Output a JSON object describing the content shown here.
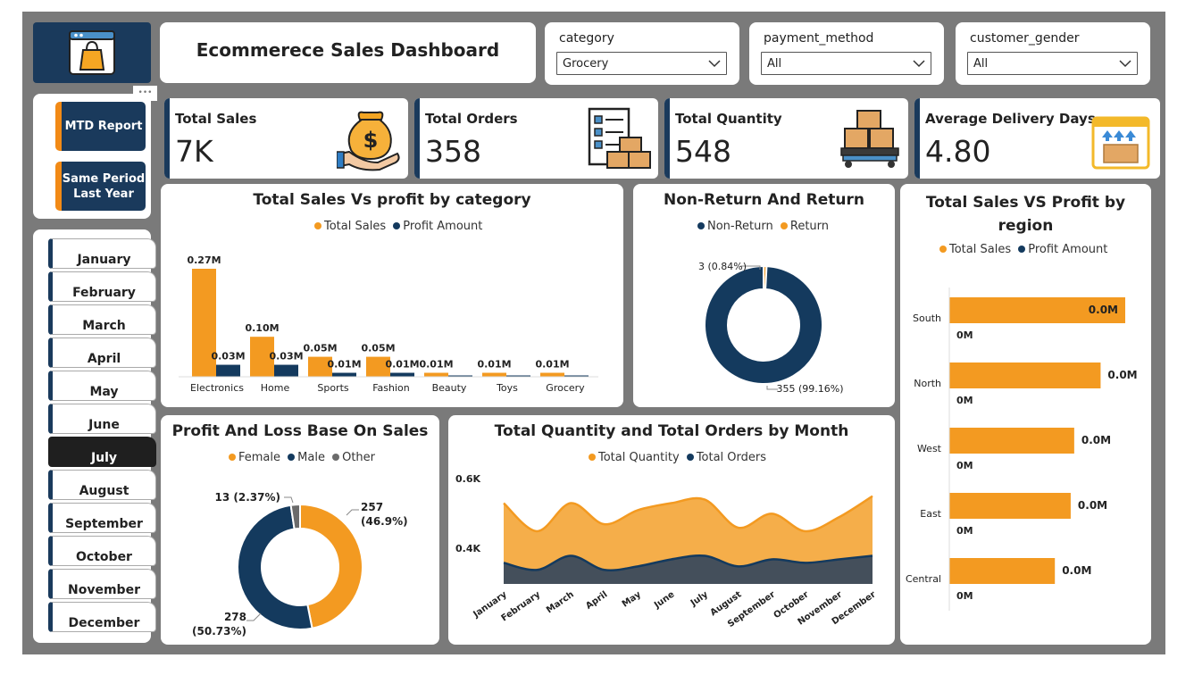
{
  "header": {
    "title": "Ecommerece Sales Dashboard"
  },
  "filters": [
    {
      "label": "category",
      "value": "Grocery"
    },
    {
      "label": "payment_method",
      "value": "All"
    },
    {
      "label": "customer_gender",
      "value": "All"
    }
  ],
  "kpis": [
    {
      "label": "Total Sales",
      "value": "7K",
      "icon": "money-bag-icon"
    },
    {
      "label": "Total Orders",
      "value": "358",
      "icon": "order-checklist-icon"
    },
    {
      "label": "Total Quantity",
      "value": "548",
      "icon": "boxes-pallet-icon"
    },
    {
      "label": "Average Delivery Days",
      "value": "4.80",
      "icon": "delivery-calendar-icon"
    }
  ],
  "report_buttons": [
    {
      "line1": "MTD Report",
      "line2": ""
    },
    {
      "line1": "Same Period",
      "line2": "Last Year"
    }
  ],
  "more_options": "•••",
  "months": [
    "January",
    "February",
    "March",
    "April",
    "May",
    "June",
    "July",
    "August",
    "September",
    "October",
    "November",
    "December"
  ],
  "selected_month": "July",
  "colors": {
    "orange": "#f39a21",
    "navy": "#143a5e",
    "gray": "#6b6b6b"
  },
  "chart_data": [
    {
      "type": "bar",
      "title": "Total Sales Vs profit by category",
      "categories": [
        "Electronics",
        "Home",
        "Sports",
        "Fashion",
        "Beauty",
        "Toys",
        "Grocery"
      ],
      "series": [
        {
          "name": "Total Sales",
          "values": [
            0.27,
            0.1,
            0.05,
            0.05,
            0.01,
            0.01,
            0.01
          ],
          "labels": [
            "0.27M",
            "0.10M",
            "0.05M",
            "0.05M",
            "0.01M",
            "0.01M",
            "0.01M"
          ]
        },
        {
          "name": "Profit Amount",
          "values": [
            0.03,
            0.03,
            0.01,
            0.01,
            0.003,
            0.001,
            0.001
          ],
          "labels": [
            "0.03M",
            "0.03M",
            "0.01M",
            "0.01M",
            "",
            "",
            ""
          ]
        }
      ],
      "ylim": [
        0,
        0.27
      ]
    },
    {
      "type": "pie",
      "title": "Non-Return And Return",
      "slices": [
        {
          "name": "Non-Return",
          "value": 355,
          "label": "355 (99.16%)"
        },
        {
          "name": "Return",
          "value": 3,
          "label": "3 (0.84%)"
        }
      ]
    },
    {
      "type": "bar",
      "title": "Total Sales VS Profit by region",
      "categories": [
        "South",
        "North",
        "West",
        "East",
        "Central"
      ],
      "series": [
        {
          "name": "Total Sales",
          "values": [
            1.0,
            0.86,
            0.71,
            0.69,
            0.6
          ],
          "labels": [
            "0.0M",
            "0.0M",
            "0.0M",
            "0.0M",
            "0.0M"
          ]
        },
        {
          "name": "Profit Amount",
          "values": [
            0,
            0,
            0,
            0,
            0
          ],
          "labels": [
            "0M",
            "0M",
            "0M",
            "0M",
            "0M"
          ]
        }
      ]
    },
    {
      "type": "pie",
      "title": "Profit And Loss Base On Sales",
      "slices": [
        {
          "name": "Female",
          "value": 257,
          "label1": "257",
          "label2": "(46.9%)"
        },
        {
          "name": "Male",
          "value": 278,
          "label1": "278",
          "label2": "(50.73%)"
        },
        {
          "name": "Other",
          "value": 13,
          "label1": "13 (2.37%)",
          "label2": ""
        }
      ]
    },
    {
      "type": "area",
      "title": "Total Quantity and Total Orders by Month",
      "x": [
        "January",
        "February",
        "March",
        "April",
        "May",
        "June",
        "July",
        "August",
        "September",
        "October",
        "November",
        "December"
      ],
      "series": [
        {
          "name": "Total Quantity",
          "values": [
            0.53,
            0.45,
            0.53,
            0.47,
            0.51,
            0.53,
            0.54,
            0.46,
            0.5,
            0.45,
            0.49,
            0.55
          ]
        },
        {
          "name": "Total Orders",
          "values": [
            0.36,
            0.34,
            0.38,
            0.34,
            0.35,
            0.37,
            0.38,
            0.35,
            0.37,
            0.36,
            0.37,
            0.38
          ]
        }
      ],
      "yticks": [
        "0.6K",
        "0.4K"
      ],
      "ylim": [
        0.3,
        0.6
      ]
    }
  ]
}
